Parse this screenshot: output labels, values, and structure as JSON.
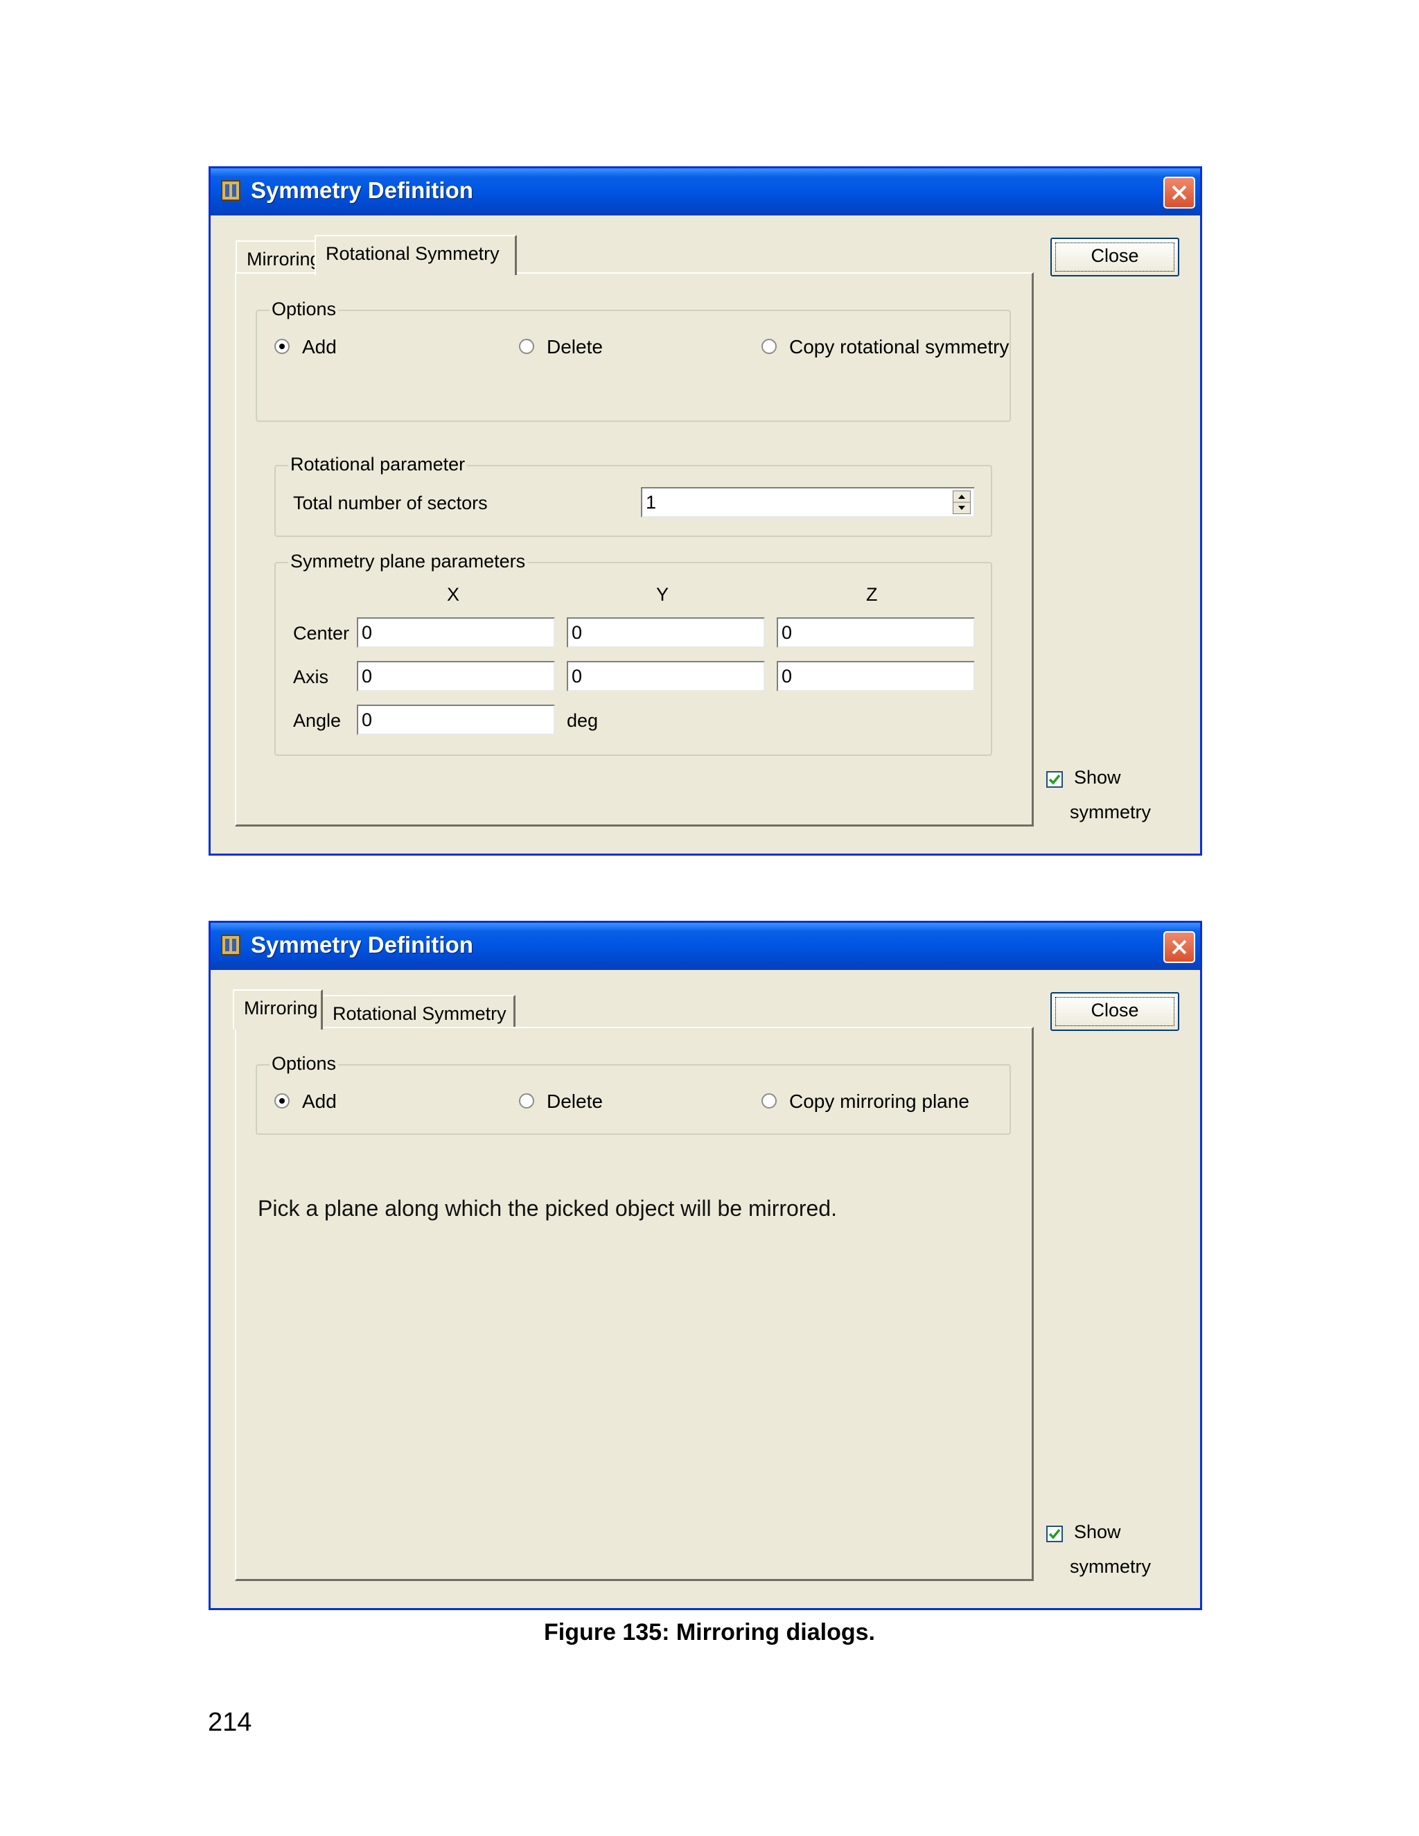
{
  "dialog_rotational": {
    "title": "Symmetry Definition",
    "tabs": [
      "Mirroring",
      "Rotational Symmetry"
    ],
    "active_tab": "Rotational Symmetry",
    "close_button": "Close",
    "options": {
      "legend": "Options",
      "add": "Add",
      "delete": "Delete",
      "copy": "Copy rotational symmetry",
      "selected": "Add"
    },
    "rotational_parameter": {
      "legend": "Rotational parameter",
      "label": "Total number of sectors",
      "value": "1"
    },
    "plane_parameters": {
      "legend": "Symmetry plane parameters",
      "col_x": "X",
      "col_y": "Y",
      "col_z": "Z",
      "center_label": "Center",
      "axis_label": "Axis",
      "angle_label": "Angle",
      "center": [
        "0",
        "0",
        "0"
      ],
      "axis": [
        "0",
        "0",
        "0"
      ],
      "angle": "0",
      "angle_unit": "deg"
    },
    "show_symmetry": {
      "line1": "Show",
      "line2": "symmetry",
      "checked": true
    }
  },
  "dialog_mirroring": {
    "title": "Symmetry Definition",
    "tabs": [
      "Mirroring",
      "Rotational Symmetry"
    ],
    "active_tab": "Mirroring",
    "close_button": "Close",
    "options": {
      "legend": "Options",
      "add": "Add",
      "delete": "Delete",
      "copy": "Copy mirroring plane",
      "selected": "Add"
    },
    "message": "Pick a plane along which the picked object will be mirrored.",
    "show_symmetry": {
      "line1": "Show",
      "line2": "symmetry",
      "checked": true
    }
  },
  "caption": "Figure 135:  Mirroring dialogs.",
  "page_number": "214"
}
